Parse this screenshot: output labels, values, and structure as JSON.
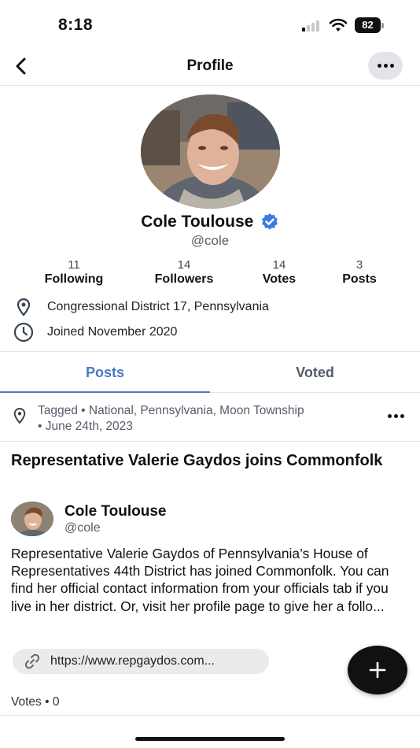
{
  "status_bar": {
    "time": "8:18",
    "battery": "82"
  },
  "nav": {
    "title": "Profile"
  },
  "profile": {
    "name": "Cole Toulouse",
    "handle": "@cole",
    "stats": [
      {
        "count": "11",
        "label": "Following"
      },
      {
        "count": "14",
        "label": "Followers"
      },
      {
        "count": "14",
        "label": "Votes"
      },
      {
        "count": "3",
        "label": "Posts"
      }
    ],
    "location": "Congressional District 17, Pennsylvania",
    "joined": "Joined November 2020"
  },
  "tabs": {
    "posts": "Posts",
    "voted": "Voted"
  },
  "post": {
    "tag_line_1": "Tagged • National, Pennsylvania, Moon Township",
    "tag_line_2": "• June 24th, 2023",
    "title": "Representative Valerie Gaydos joins Commonfolk",
    "author_name": "Cole Toulouse",
    "author_handle": "@cole",
    "body": "Representative Valerie Gaydos of Pennsylvania’s House of Representatives 44th District has joined Commonfolk. You can find her official contact information from your officials tab if you live in her district. Or, visit her profile page to give her a follo...",
    "link": "https://www.repgaydos.com...",
    "votes": "Votes • 0"
  },
  "colors": {
    "accent": "#4a78c4",
    "verified": "#3b7be0",
    "muted": "#555d6a"
  },
  "icons": [
    "chevron-left-icon",
    "more-icon",
    "verified-icon",
    "location-pin-icon",
    "clock-icon",
    "link-icon",
    "plus-icon"
  ]
}
